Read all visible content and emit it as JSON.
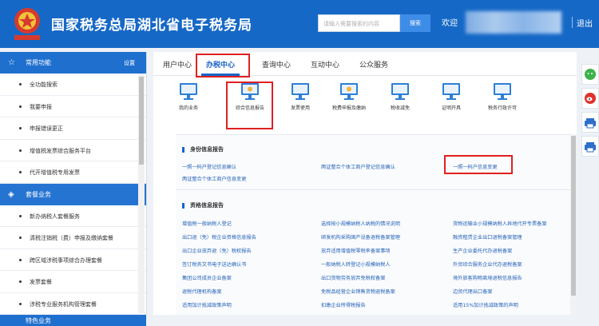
{
  "header": {
    "title": "国家税务总局湖北省电子税务局",
    "search_placeholder": "请输入需要搜索的内容",
    "search_button": "搜索",
    "welcome": "欢迎",
    "logout": "退出"
  },
  "sidebar": {
    "common_title": "常用功能",
    "settings": "设置",
    "common_items": [
      "全功能搜索",
      "我要申报",
      "申报错误更正",
      "增值税发票综合服务平台",
      "代开增值税专用发票"
    ],
    "package_title": "套餐业务",
    "package_items": [
      "新办纳税人套餐服务",
      "清税注销税（费）申报及缴纳套餐",
      "跨区域涉税事项综合办理套餐",
      "发票套餐",
      "涉税专业服务机构管理套餐"
    ],
    "special_title": "特色业务"
  },
  "tabs": [
    "用户中心",
    "办税中心",
    "查询中心",
    "互动中心",
    "公众服务"
  ],
  "active_tab": "办税中心",
  "functions": [
    "我的业务",
    "综合信息报告",
    "发票使用",
    "税费申报及缴纳",
    "税收减免",
    "证明开具",
    "税务行政许可"
  ],
  "sections": {
    "identity": {
      "title": "身份信息报告",
      "links": [
        "一照一码户登记信息确认",
        "两证整合个体工商户登记信息确认",
        "一照一码户信息变更",
        "两证整合个体工商户信息变更"
      ]
    },
    "qualification": {
      "title": "资格信息报告",
      "links": [
        "增值税一般纳税人登记",
        "选择按小规模纳税人纳税的情况说明",
        "货物运输业小规模纳税人异地代开专票备案",
        "出口退（免）税企业资格信息报告",
        "研发机构采购国产设备退税备案管理",
        "融资租赁企业出口退税备案管理",
        "出口企业放弃退（免）税权报告",
        "放弃适用增值税零税率备案事项",
        "生产企业委托代办退税备案",
        "签订税务文书电子送达确认书",
        "一般纳税人转登记小规模纳税人",
        "外贸综合服务企业代办退税备案",
        "集团公司成员企业备案",
        "出口货物劳务放弃免税权备案",
        "境外旅客购物离境退税信息报告",
        "退税代理机构备案",
        "免税品经营企业销售货物退税备案",
        "边贸代理出口备案",
        "适用加计抵减政策声明",
        "扣缴企业所得税报告",
        "适用15%加计抵减政策的声明"
      ]
    }
  }
}
